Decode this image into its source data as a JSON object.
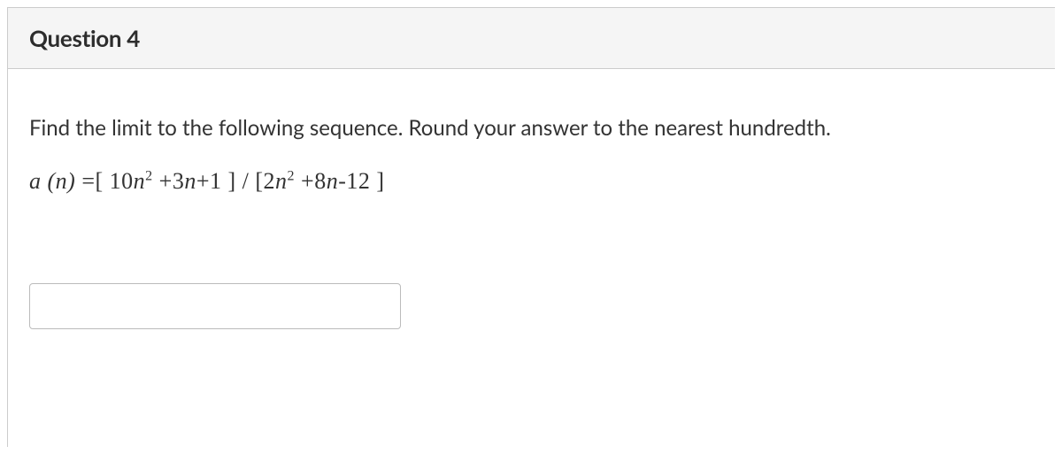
{
  "question": {
    "title": "Question 4",
    "prompt": "Find the limit to the following sequence. Round your answer to the nearest hundredth.",
    "formula_html": "<span>a</span> (<span>n</span>) <span class=\"upright\">=[ 10</span><span>n</span><sup>2</sup> <span class=\"upright\">+3</span><span>n</span><span class=\"upright\">+1 ] / [2</span><span>n</span><sup>2</sup> <span class=\"upright\">+8</span><span>n</span><span class=\"upright\">-12 ]</span>",
    "answer_value": ""
  }
}
